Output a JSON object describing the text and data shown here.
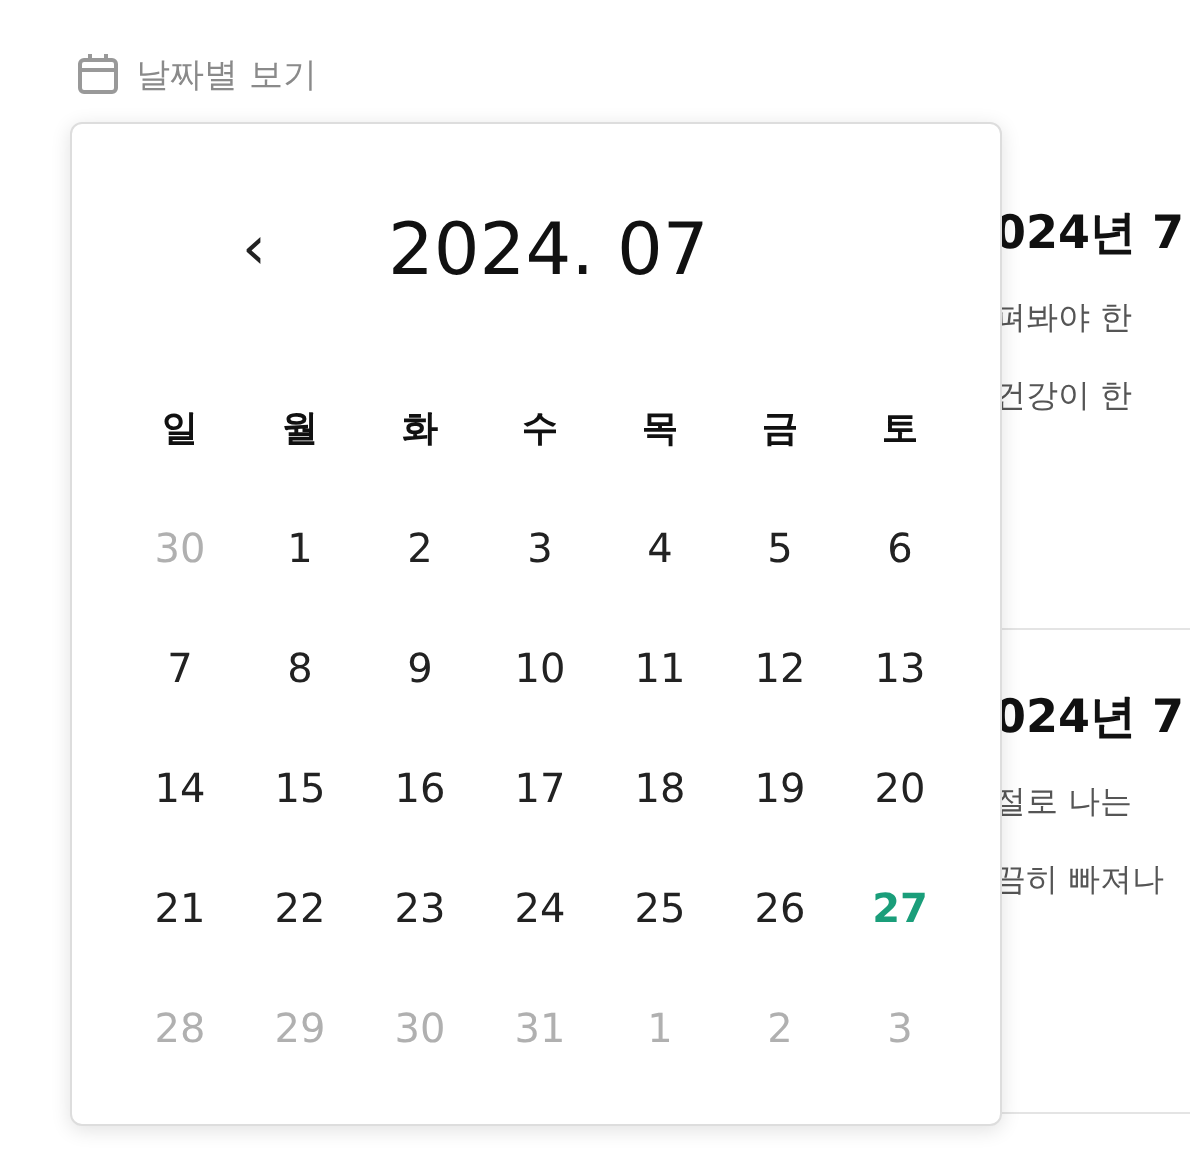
{
  "filter": {
    "label": "날짜별 보기"
  },
  "articles": [
    {
      "title": "024년 7",
      "lines": [
        "펴봐야 한",
        "건강이 한"
      ]
    },
    {
      "title": "024년 7",
      "lines": [
        "절로 나는",
        "끔히 빠져나"
      ]
    }
  ],
  "calendar": {
    "prev": "‹",
    "title": "2024. 07",
    "weekdays": [
      "일",
      "월",
      "화",
      "수",
      "목",
      "금",
      "토"
    ],
    "days": [
      {
        "label": "30",
        "kind": "other"
      },
      {
        "label": "1",
        "kind": "current"
      },
      {
        "label": "2",
        "kind": "current"
      },
      {
        "label": "3",
        "kind": "current"
      },
      {
        "label": "4",
        "kind": "current"
      },
      {
        "label": "5",
        "kind": "current"
      },
      {
        "label": "6",
        "kind": "current"
      },
      {
        "label": "7",
        "kind": "current"
      },
      {
        "label": "8",
        "kind": "current"
      },
      {
        "label": "9",
        "kind": "current"
      },
      {
        "label": "10",
        "kind": "current"
      },
      {
        "label": "11",
        "kind": "current"
      },
      {
        "label": "12",
        "kind": "current"
      },
      {
        "label": "13",
        "kind": "current"
      },
      {
        "label": "14",
        "kind": "current"
      },
      {
        "label": "15",
        "kind": "current"
      },
      {
        "label": "16",
        "kind": "current"
      },
      {
        "label": "17",
        "kind": "current"
      },
      {
        "label": "18",
        "kind": "current"
      },
      {
        "label": "19",
        "kind": "current"
      },
      {
        "label": "20",
        "kind": "current"
      },
      {
        "label": "21",
        "kind": "current"
      },
      {
        "label": "22",
        "kind": "current"
      },
      {
        "label": "23",
        "kind": "current"
      },
      {
        "label": "24",
        "kind": "current"
      },
      {
        "label": "25",
        "kind": "current"
      },
      {
        "label": "26",
        "kind": "current"
      },
      {
        "label": "27",
        "kind": "today"
      },
      {
        "label": "28",
        "kind": "other"
      },
      {
        "label": "29",
        "kind": "other"
      },
      {
        "label": "30",
        "kind": "other"
      },
      {
        "label": "31",
        "kind": "other"
      },
      {
        "label": "1",
        "kind": "other"
      },
      {
        "label": "2",
        "kind": "other"
      },
      {
        "label": "3",
        "kind": "other"
      }
    ]
  }
}
